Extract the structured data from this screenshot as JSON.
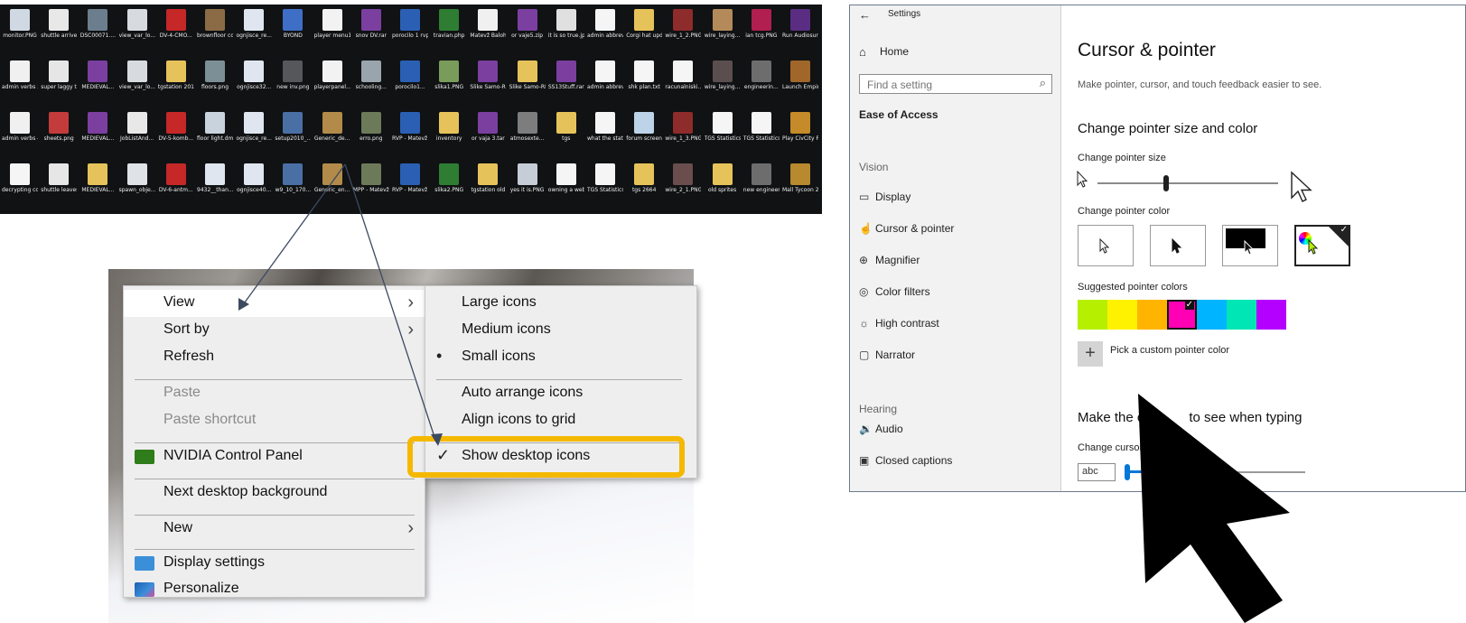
{
  "desktop_icons": {
    "row1": [
      {
        "label": "monitor.PNG",
        "color": "#cfd8e3"
      },
      {
        "label": "shuttle arrives.PNG",
        "color": "#e8e8e8"
      },
      {
        "label": "DSC00071....",
        "color": "#6c7d8e"
      },
      {
        "label": "view_var_lo...",
        "color": "#d7dbe0"
      },
      {
        "label": "DV-4-CMO...",
        "color": "#c62828"
      },
      {
        "label": "brownfloor copy.png",
        "color": "#8b6b45"
      },
      {
        "label": "ognjisce_re...",
        "color": "#dfe6ef"
      },
      {
        "label": "BYOND",
        "color": "#3f6ec6"
      },
      {
        "label": "player menu1.PNG",
        "color": "#f2f2f2"
      },
      {
        "label": "snov DV.rar",
        "color": "#7b3fa0"
      },
      {
        "label": "porocilo 1 rvp.doc",
        "color": "#2b5fb4"
      },
      {
        "label": "travian.php",
        "color": "#2e7d32"
      },
      {
        "label": "Matevž Baloh - Predlog te...",
        "color": "#f0f0f0"
      },
      {
        "label": "or vaje5.zip",
        "color": "#7b3fa0"
      },
      {
        "label": "it is so true.jpg",
        "color": "#e0e0e0"
      },
      {
        "label": "admin abbreviatio...",
        "color": "#f5f5f5"
      },
      {
        "label": "Corgi hat update",
        "color": "#e6c35a"
      },
      {
        "label": "wire_1_2.PNG",
        "color": "#8e2b2b"
      },
      {
        "label": "wire_laying...",
        "color": "#b48a5a"
      },
      {
        "label": "ian tcg.PNG",
        "color": "#b01f4f"
      },
      {
        "label": "Run Audiosurf",
        "color": "#5a2d82"
      }
    ],
    "row2": [
      {
        "label": "admin verbs 3.PNG",
        "color": "#f0f0f0"
      },
      {
        "label": "super laggy time.PNG",
        "color": "#e6e6e6"
      },
      {
        "label": "MEDIEVAL...",
        "color": "#7b3fa0"
      },
      {
        "label": "view_var_lo...",
        "color": "#d7dbe0"
      },
      {
        "label": "tgstation 2011-09-28",
        "color": "#e6c35a"
      },
      {
        "label": "floors.png",
        "color": "#7d8f96"
      },
      {
        "label": "ognjisce32...",
        "color": "#dfe6ef"
      },
      {
        "label": "new inv.png",
        "color": "#55575a"
      },
      {
        "label": "playerpanel...",
        "color": "#f2f2f2"
      },
      {
        "label": "schooling...",
        "color": "#9aa4ad"
      },
      {
        "label": "porocilo1...",
        "color": "#2b5fb4"
      },
      {
        "label": "slika1.PNG",
        "color": "#7a9c5a"
      },
      {
        "label": "Slike Samo-RD.rar",
        "color": "#7b3fa0"
      },
      {
        "label": "Slike Samo-RD",
        "color": "#e6c35a"
      },
      {
        "label": "SS13Stuff.rar",
        "color": "#7b3fa0"
      },
      {
        "label": "admin abbreviatio...",
        "color": "#f5f5f5"
      },
      {
        "label": "shk plan.txt",
        "color": "#f5f5f5"
      },
      {
        "label": "racunalniski...",
        "color": "#f5f5f5"
      },
      {
        "label": "wire_laying...",
        "color": "#5b4e4e"
      },
      {
        "label": "engineerin...",
        "color": "#6d6d6d"
      },
      {
        "label": "Launch Empire Ea...",
        "color": "#a0662a"
      }
    ],
    "row3": [
      {
        "label": "admin verbs 4.PNG",
        "color": "#f0f0f0"
      },
      {
        "label": "sheets.png",
        "color": "#c43b3b"
      },
      {
        "label": "MEDIEVAL...",
        "color": "#7b3fa0"
      },
      {
        "label": "JobListAnd...",
        "color": "#e8e8e8"
      },
      {
        "label": "DV-5-komb...",
        "color": "#c62828"
      },
      {
        "label": "floor light.dmi",
        "color": "#c9d3de"
      },
      {
        "label": "ognjisce_re...",
        "color": "#dfe6ef"
      },
      {
        "label": "setup2010_...",
        "color": "#4a6fa5"
      },
      {
        "label": "Generic_de...",
        "color": "#b28b4a"
      },
      {
        "label": "erro.png",
        "color": "#6d7a5a"
      },
      {
        "label": "RVP - Matevž Baloh - Por...",
        "color": "#2b5fb4"
      },
      {
        "label": "inventory",
        "color": "#e6c35a"
      },
      {
        "label": "or vaja 3.tar",
        "color": "#7b3fa0"
      },
      {
        "label": "atmosexte...",
        "color": "#7d7d7d"
      },
      {
        "label": "tgs",
        "color": "#e6c35a"
      },
      {
        "label": "what the station...",
        "color": "#f5f5f5"
      },
      {
        "label": "forum screenshot...",
        "color": "#bcd3e8"
      },
      {
        "label": "wire_1_3.PNG",
        "color": "#8e2b2b"
      },
      {
        "label": "TGS Statistics 2011-12-19...",
        "color": "#f5f5f5"
      },
      {
        "label": "TGS Statistics 2011-12-24...",
        "color": "#f5f5f5"
      },
      {
        "label": "Play CivCity Rome",
        "color": "#c58a2a"
      }
    ],
    "row4": [
      {
        "label": "decrypting code.txt",
        "color": "#f5f5f5"
      },
      {
        "label": "shuttle leaves.PNG",
        "color": "#e6e6e6"
      },
      {
        "label": "MEDIEVAL...",
        "color": "#e6c35a"
      },
      {
        "label": "spawn_obje...",
        "color": "#dfe3e8"
      },
      {
        "label": "DV-6-antm...",
        "color": "#c62828"
      },
      {
        "label": "9432__than...",
        "color": "#dfe6ef"
      },
      {
        "label": "ognjisce40...",
        "color": "#dfe6ef"
      },
      {
        "label": "w9_10_170...",
        "color": "#4a6fa5"
      },
      {
        "label": "Generic_en...",
        "color": "#b28b4a"
      },
      {
        "label": "MPP - Matevž ...",
        "color": "#6d7a5a"
      },
      {
        "label": "RVP - Matevž Baloh - Por...",
        "color": "#2b5fb4"
      },
      {
        "label": "slika2.PNG",
        "color": "#2e7d32"
      },
      {
        "label": "tgstation old",
        "color": "#e6c35a"
      },
      {
        "label": "yes it is.PNG",
        "color": "#c7cdd6"
      },
      {
        "label": "owning a website.html",
        "color": "#f5f5f5"
      },
      {
        "label": "TGS Statistics 2011-12-16...",
        "color": "#f5f5f5"
      },
      {
        "label": "tgs 2664",
        "color": "#e6c35a"
      },
      {
        "label": "wire_2_1.PNG",
        "color": "#6a4d4d"
      },
      {
        "label": "old sprites",
        "color": "#e6c35a"
      },
      {
        "label": "new engineerin...",
        "color": "#6d6d6d"
      },
      {
        "label": "Mall Tycoon 2 Deluxe",
        "color": "#b8892e"
      }
    ]
  },
  "context_menu": {
    "items": [
      {
        "label": "View",
        "has_submenu": true,
        "highlighted": true
      },
      {
        "label": "Sort by",
        "has_submenu": true
      },
      {
        "label": "Refresh"
      },
      {
        "label": "Paste",
        "disabled": true
      },
      {
        "label": "Paste shortcut",
        "disabled": true
      },
      {
        "label": "NVIDIA Control Panel",
        "icon": "nvidia-icon"
      },
      {
        "label": "Next desktop background"
      },
      {
        "label": "New",
        "has_submenu": true
      },
      {
        "label": "Display settings",
        "icon": "display-icon"
      },
      {
        "label": "Personalize",
        "icon": "personalize-icon"
      }
    ],
    "arrow_glyph": "›"
  },
  "view_submenu": {
    "items": [
      {
        "label": "Large icons"
      },
      {
        "label": "Medium icons"
      },
      {
        "label": "Small icons",
        "bullet": "•"
      },
      {
        "label": "Auto arrange icons"
      },
      {
        "label": "Align icons to grid"
      },
      {
        "label": "Show desktop icons",
        "check": "✓"
      }
    ],
    "highlight_color": "#f5b800"
  },
  "settings": {
    "title": "Settings",
    "back_glyph": "←",
    "home_label": "Home",
    "search_placeholder": "Find a setting",
    "category": "Ease of Access",
    "vision_header": "Vision",
    "vision_items": [
      {
        "label": "Display",
        "icon": "display-icon",
        "glyph": "▭"
      },
      {
        "label": "Cursor & pointer",
        "icon": "cursor-icon",
        "glyph": "☝"
      },
      {
        "label": "Magnifier",
        "icon": "magnifier-icon",
        "glyph": "⊕"
      },
      {
        "label": "Color filters",
        "icon": "color-filters-icon",
        "glyph": "◎"
      },
      {
        "label": "High contrast",
        "icon": "high-contrast-icon",
        "glyph": "☼"
      },
      {
        "label": "Narrator",
        "icon": "narrator-icon",
        "glyph": "▢"
      }
    ],
    "hearing_header": "Hearing",
    "hearing_items": [
      {
        "label": "Audio",
        "icon": "audio-icon",
        "glyph": "🔉"
      },
      {
        "label": "Closed captions",
        "icon": "closed-captions-icon",
        "glyph": "▣"
      }
    ],
    "main": {
      "title": "Cursor & pointer",
      "description": "Make pointer, cursor, and touch feedback easier to see.",
      "section1": "Change pointer size and color",
      "size_label": "Change pointer size",
      "pointer_size_value": 0.38,
      "color_label": "Change pointer color",
      "color_options": [
        "white",
        "black",
        "inverted",
        "custom"
      ],
      "suggested_label": "Suggested pointer colors",
      "suggested_colors": [
        "#b6f000",
        "#fff200",
        "#ffb400",
        "#ff00b4",
        "#00b4ff",
        "#00e6b4",
        "#b400ff"
      ],
      "selected_color_index": 3,
      "pick_custom_label": "Pick a custom pointer color",
      "section2": "Make the cu          to see when typing",
      "thickness_label": "Change cursor th",
      "thickness_preview": "abc"
    }
  }
}
